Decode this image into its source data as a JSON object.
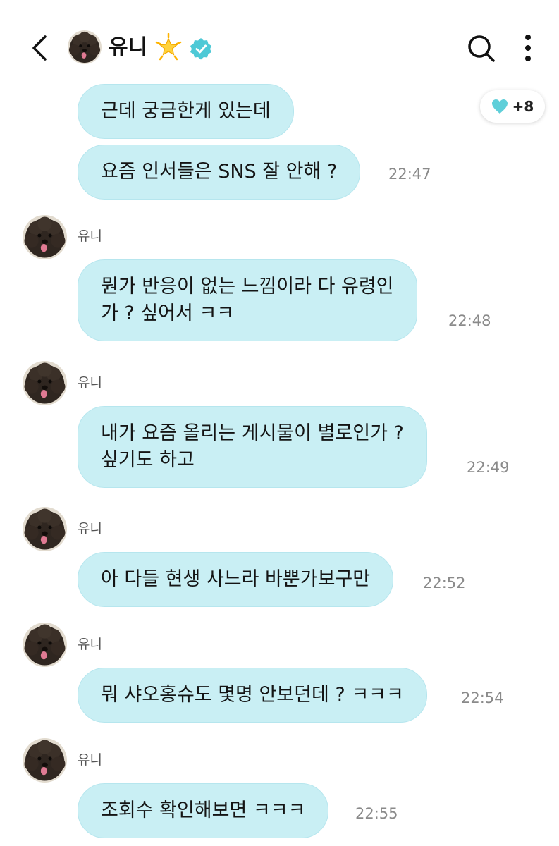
{
  "header": {
    "name": "유니",
    "avatar_icon": "poodle-avatar",
    "star_icon": "glowing-star-emoji",
    "verified_icon": "verified-badge-icon",
    "search_icon": "search-icon",
    "more_icon": "more-vertical-icon",
    "back_icon": "chevron-left-icon",
    "accent_color": "#4ec9d6"
  },
  "reaction": {
    "icon": "heart-icon",
    "count": "+8",
    "color": "#5fcfd9"
  },
  "bubble_color": "#c9eff4",
  "messages": [
    {
      "sender": "",
      "text": "근데 궁금한게 있는데",
      "time": ""
    },
    {
      "sender": "",
      "text": "요즘 인서들은 SNS 잘 안해 ?",
      "time": "22:47"
    },
    {
      "sender": "유니",
      "text": "뭔가 반응이 없는 느낌이라 다 유령인\n가 ? 싶어서 ㅋㅋ",
      "time": "22:48"
    },
    {
      "sender": "유니",
      "text": "내가 요즘 올리는 게시물이 별로인가 ?\n싶기도 하고",
      "time": "22:49"
    },
    {
      "sender": "유니",
      "text": "아 다들 현생 사느라 바뿐가보구만",
      "time": "22:52"
    },
    {
      "sender": "유니",
      "text": "뭐 샤오홍슈도 몇명 안보던데 ? ㅋㅋㅋ",
      "time": "22:54"
    },
    {
      "sender": "유니",
      "text": "조회수 확인해보면 ㅋㅋㅋ",
      "time": "22:55"
    }
  ]
}
